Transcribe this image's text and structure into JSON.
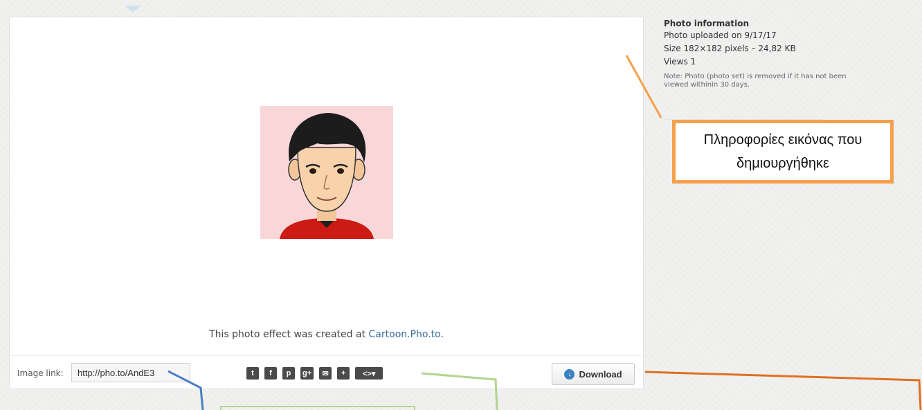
{
  "photo_panel": {
    "credit_prefix": "This photo effect was created at ",
    "credit_link": "Cartoon.Pho.to",
    "credit_suffix": "."
  },
  "toolbar": {
    "image_link_label": "Image link:",
    "image_link_value": "http://pho.to/AndE3",
    "share_buttons": [
      {
        "icon": "twitter-icon",
        "glyph": "t"
      },
      {
        "icon": "facebook-icon",
        "glyph": "f"
      },
      {
        "icon": "pinterest-icon",
        "glyph": "p"
      },
      {
        "icon": "google-plus-icon",
        "glyph": "g+"
      },
      {
        "icon": "email-icon",
        "glyph": "✉"
      },
      {
        "icon": "more-share-icon",
        "glyph": "+"
      },
      {
        "icon": "embed-code-icon",
        "glyph": "<>▾"
      }
    ],
    "download_label": "Download"
  },
  "info": {
    "title": "Photo information",
    "uploaded": "Photo uploaded on 9/17/17",
    "size": "Size 182×182 pixels – 24,82 KB",
    "views": "Views 1",
    "note": "Note: Photo (photo set) is removed if it has not been viewed withinin 30 days."
  },
  "annotation": {
    "callout_line1": "Πληροφορίες εικόνας που",
    "callout_line2": "δημιουργήθηκε",
    "colors": {
      "orange": "#f5a04c",
      "dark_orange": "#e07020",
      "blue": "#4a7fc4",
      "green": "#b3d58f"
    }
  }
}
